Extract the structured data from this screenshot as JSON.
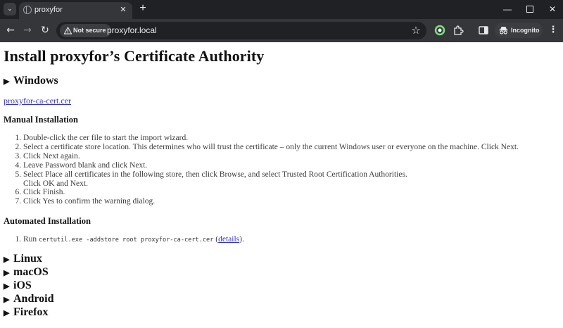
{
  "browser": {
    "tab_title": "proxyfor",
    "security_label": "Not secure",
    "url": "proxyfor.local",
    "profile_label": "Incognito"
  },
  "page": {
    "title": "Install proxyfor’s Certificate Authority",
    "windows": {
      "heading": "Windows",
      "cert_link": "proxyfor-ca-cert.cer",
      "manual_heading": "Manual Installation",
      "manual_steps": [
        "Double-click the cer file to start the import wizard.",
        "Select a certificate store location. This determines who will trust the certificate – only the current Windows user or everyone on the machine. Click Next.",
        "Click Next again.",
        "Leave Password blank and click Next.",
        "Select Place all certificates in the following store, then click Browse, and select Trusted Root Certification Authorities.",
        "Click OK and Next.",
        "Click Finish.",
        "Click Yes to confirm the warning dialog."
      ],
      "automated_heading": "Automated Installation",
      "automated_step_prefix": "Run",
      "automated_command": "certutil.exe -addstore root proxyfor-ca-cert.cer",
      "automated_link_open": "(",
      "automated_link": "details",
      "automated_link_close": ")."
    },
    "other_sections": [
      "Linux",
      "macOS",
      "iOS",
      "Android",
      "Firefox"
    ]
  }
}
